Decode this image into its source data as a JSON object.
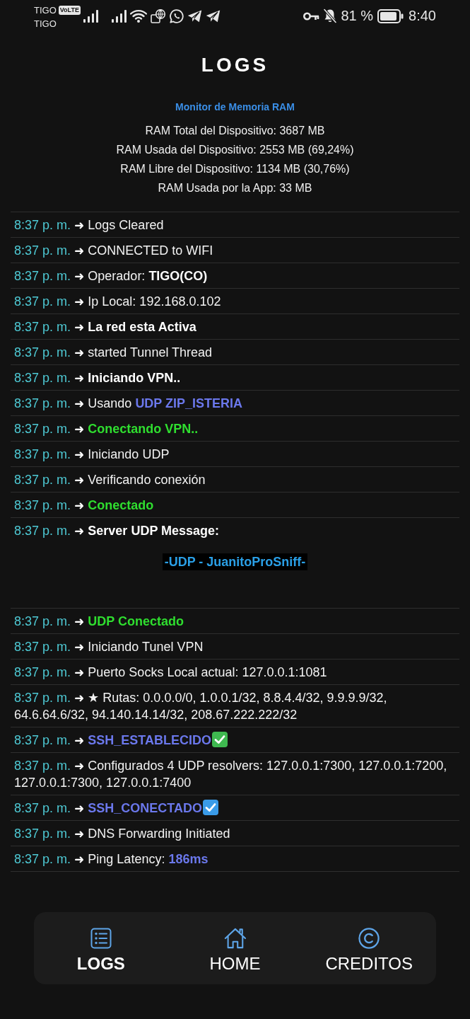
{
  "status_bar": {
    "carrier_primary": "TIGO",
    "network_badge": "VoLTE",
    "carrier_secondary": "TIGO",
    "battery_percent": "81 %",
    "time": "8:40"
  },
  "header": {
    "title": "LOGS"
  },
  "memory_monitor": {
    "title": "Monitor de Memoria RAM",
    "lines": [
      "RAM Total del Dispositivo: 3687 MB",
      "RAM Usada del Dispositivo: 2553 MB (69,24%)",
      "RAM Libre del Dispositivo: 1134 MB (30,76%)",
      "RAM Usada por la App: 33 MB"
    ]
  },
  "logs": [
    {
      "time": "8:37 p. m.",
      "arrow": "➜",
      "parts": [
        {
          "kind": "plain",
          "text": "Logs Cleared"
        }
      ]
    },
    {
      "time": "8:37 p. m.",
      "arrow": "➜",
      "parts": [
        {
          "kind": "plain",
          "text": "CONNECTED to WIFI"
        }
      ]
    },
    {
      "time": "8:37 p. m.",
      "arrow": "➜",
      "parts": [
        {
          "kind": "plain",
          "text": "Operador: "
        },
        {
          "kind": "bold",
          "text": "TIGO(CO)"
        }
      ]
    },
    {
      "time": "8:37 p. m.",
      "arrow": "➜",
      "parts": [
        {
          "kind": "plain",
          "text": "Ip Local: 192.168.0.102"
        }
      ]
    },
    {
      "time": "8:37 p. m.",
      "arrow": "➜",
      "parts": [
        {
          "kind": "bold",
          "text": "La red esta Activa"
        }
      ]
    },
    {
      "time": "8:37 p. m.",
      "arrow": "➜",
      "parts": [
        {
          "kind": "plain",
          "text": "started Tunnel Thread"
        }
      ]
    },
    {
      "time": "8:37 p. m.",
      "arrow": "➜",
      "parts": [
        {
          "kind": "bold",
          "text": "Iniciando VPN.."
        }
      ]
    },
    {
      "time": "8:37 p. m.",
      "arrow": "➜",
      "parts": [
        {
          "kind": "plain",
          "text": "Usando "
        },
        {
          "kind": "accent",
          "text": "UDP ZIP_ISTERIA"
        }
      ]
    },
    {
      "time": "8:37 p. m.",
      "arrow": "➜",
      "parts": [
        {
          "kind": "success",
          "text": "Conectando VPN.."
        }
      ]
    },
    {
      "time": "8:37 p. m.",
      "arrow": "➜",
      "parts": [
        {
          "kind": "plain",
          "text": "Iniciando UDP"
        }
      ]
    },
    {
      "time": "8:37 p. m.",
      "arrow": "➜",
      "parts": [
        {
          "kind": "plain",
          "text": "Verificando conexión"
        }
      ]
    },
    {
      "time": "8:37 p. m.",
      "arrow": "➜",
      "parts": [
        {
          "kind": "success",
          "text": "Conectado"
        }
      ]
    },
    {
      "time": "8:37 p. m.",
      "arrow": "➜",
      "parts": [
        {
          "kind": "bold",
          "text": "Server UDP Message:"
        }
      ],
      "banner": "-UDP - JuanitoProSniff-"
    },
    {
      "time": "8:37 p. m.",
      "arrow": "➜",
      "parts": [
        {
          "kind": "success",
          "text": "UDP Conectado"
        }
      ]
    },
    {
      "time": "8:37 p. m.",
      "arrow": "➜",
      "parts": [
        {
          "kind": "plain",
          "text": "Iniciando Tunel VPN"
        }
      ]
    },
    {
      "time": "8:37 p. m.",
      "arrow": "➜",
      "parts": [
        {
          "kind": "plain",
          "text": "Puerto Socks Local actual: 127.0.0.1:1081"
        }
      ]
    },
    {
      "time": "8:37 p. m.",
      "arrow": "➜",
      "parts": [
        {
          "kind": "plain",
          "text": "★ Rutas: 0.0.0.0/0, 1.0.0.1/32, 8.8.4.4/32, 9.9.9.9/32, 64.6.64.6/32, 94.140.14.14/32, 208.67.222.222/32"
        }
      ]
    },
    {
      "time": "8:37 p. m.",
      "arrow": "➜",
      "parts": [
        {
          "kind": "accent",
          "text": "SSH_ESTABLECIDO"
        }
      ],
      "check": {
        "color": "#3fb950"
      }
    },
    {
      "time": "8:37 p. m.",
      "arrow": "➜",
      "parts": [
        {
          "kind": "plain",
          "text": "Configurados 4 UDP resolvers: 127.0.0.1:7300, 127.0.0.1:7200, 127.0.0.1:7300, 127.0.0.1:7400"
        }
      ]
    },
    {
      "time": "8:37 p. m.",
      "arrow": "➜",
      "parts": [
        {
          "kind": "accent",
          "text": "SSH_CONECTADO"
        }
      ],
      "check": {
        "color": "#3a9be8"
      }
    },
    {
      "time": "8:37 p. m.",
      "arrow": "➜",
      "parts": [
        {
          "kind": "plain",
          "text": "DNS Forwarding Initiated"
        }
      ]
    },
    {
      "time": "8:37 p. m.",
      "arrow": "➜",
      "parts": [
        {
          "kind": "plain",
          "text": "Ping Latency: "
        },
        {
          "kind": "accent",
          "text": "186ms"
        }
      ]
    }
  ],
  "bottom_nav": {
    "tabs": [
      {
        "label": "LOGS",
        "selected": true
      },
      {
        "label": "HOME",
        "selected": false
      },
      {
        "label": "CREDITOS",
        "selected": false
      }
    ]
  }
}
